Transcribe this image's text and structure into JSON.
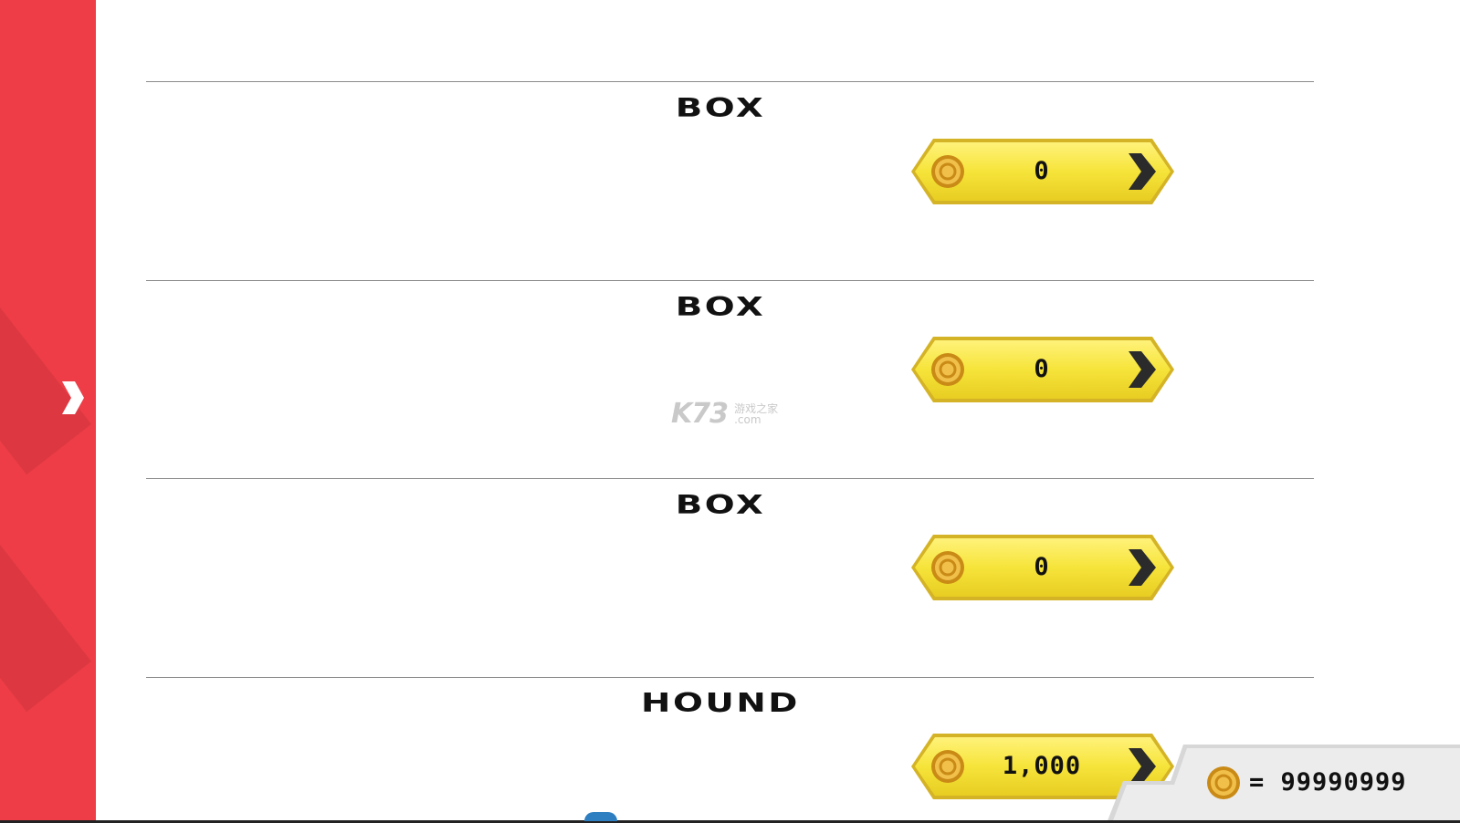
{
  "sidebar": {
    "toggle_icon": "chevron-right-icon",
    "color": "#ee3d47"
  },
  "items": [
    {
      "name": "BOX",
      "price": "0"
    },
    {
      "name": "BOX",
      "price": "0"
    },
    {
      "name": "BOX",
      "price": "0"
    },
    {
      "name": "HOUND",
      "price": "1,000"
    }
  ],
  "balance": {
    "text": "= 99990999",
    "icon": "coin-icon"
  },
  "watermark": {
    "main": "K73",
    "line1": "游戏之家",
    "line2": ".com"
  },
  "colors": {
    "button_yellow": "#f6e63a",
    "button_border": "#c9a820",
    "coin_gold": "#e3a928",
    "arrow_dark": "#2b2b2b"
  }
}
